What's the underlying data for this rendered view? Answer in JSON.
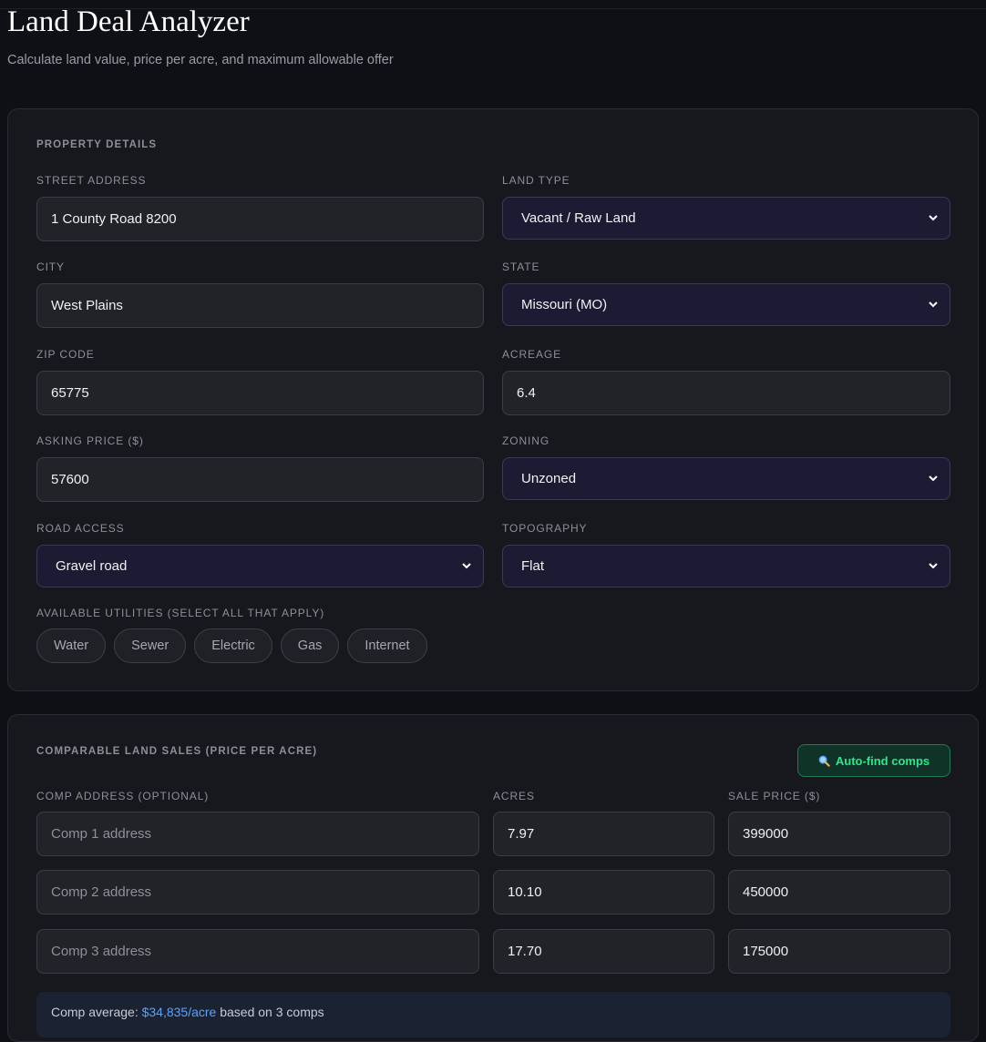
{
  "header": {
    "title": "Land Deal Analyzer",
    "subtitle": "Calculate land value, price per acre, and maximum allowable offer"
  },
  "property": {
    "section_title": "PROPERTY DETAILS",
    "street_address": {
      "label": "STREET ADDRESS",
      "value": "1 County Road 8200"
    },
    "land_type": {
      "label": "LAND TYPE",
      "value": "Vacant / Raw Land"
    },
    "city": {
      "label": "CITY",
      "value": "West Plains"
    },
    "state": {
      "label": "STATE",
      "value": "Missouri (MO)"
    },
    "zip": {
      "label": "ZIP CODE",
      "value": "65775"
    },
    "acreage": {
      "label": "ACREAGE",
      "value": "6.4"
    },
    "asking_price": {
      "label": "ASKING PRICE ($)",
      "value": "57600"
    },
    "zoning": {
      "label": "ZONING",
      "value": "Unzoned"
    },
    "road_access": {
      "label": "ROAD ACCESS",
      "value": "Gravel road"
    },
    "topography": {
      "label": "TOPOGRAPHY",
      "value": "Flat"
    },
    "utilities_label": "AVAILABLE UTILITIES (SELECT ALL THAT APPLY)",
    "utilities": [
      "Water",
      "Sewer",
      "Electric",
      "Gas",
      "Internet"
    ]
  },
  "comps": {
    "section_title": "COMPARABLE LAND SALES (PRICE PER ACRE)",
    "auto_find_label": "Auto-find comps",
    "col_address": "COMP ADDRESS (OPTIONAL)",
    "col_acres": "ACRES",
    "col_price": "SALE PRICE ($)",
    "rows": [
      {
        "address_placeholder": "Comp 1 address",
        "acres": "7.97",
        "price": "399000"
      },
      {
        "address_placeholder": "Comp 2 address",
        "acres": "10.10",
        "price": "450000"
      },
      {
        "address_placeholder": "Comp 3 address",
        "acres": "17.70",
        "price": "175000"
      }
    ],
    "summary_prefix": "Comp average: ",
    "summary_value": "$34,835/acre",
    "summary_suffix": " based on 3 comps"
  },
  "colors": {
    "accent_green": "#2ee58c",
    "accent_blue": "#5aa2ff",
    "background": "#0f1015",
    "card": "#17181e"
  },
  "icons": {
    "select_arrow": "chevron-down-icon",
    "auto_find": "magnifier-icon"
  }
}
